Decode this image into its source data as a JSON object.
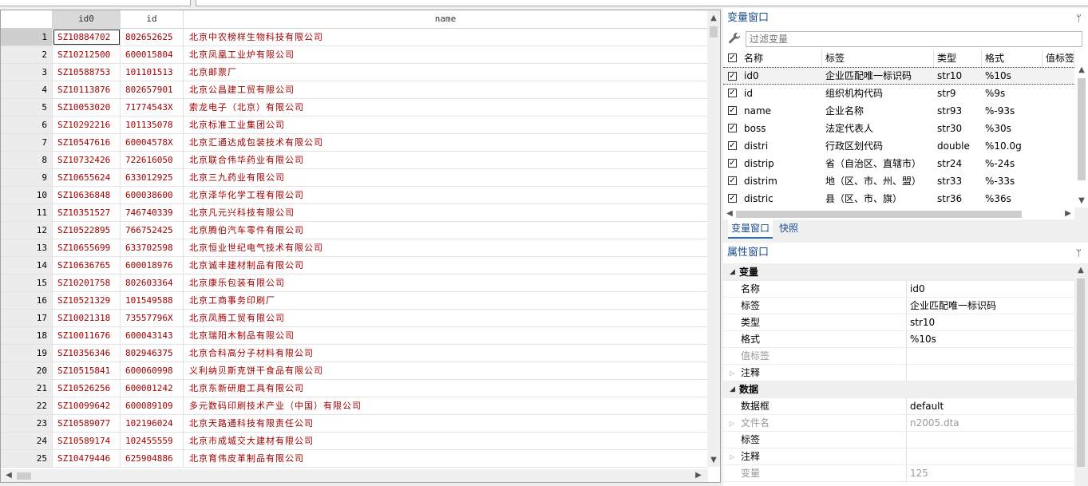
{
  "toolbar": {
    "cmd_left": "",
    "cmd_right": ""
  },
  "grid": {
    "columns": [
      "id0",
      "id",
      "name"
    ],
    "rows": [
      [
        "1",
        "SZ10884702",
        "802652625",
        "北京中农榜样生物科技有限公司"
      ],
      [
        "2",
        "SZ10212500",
        "600015804",
        "北京凤凰工业炉有限公司"
      ],
      [
        "3",
        "SZ10588753",
        "101101513",
        "北京邮票厂"
      ],
      [
        "4",
        "SZ10113876",
        "802657901",
        "北京公昌建工贸有限公司"
      ],
      [
        "5",
        "SZ10053020",
        "71774543X",
        "索龙电子（北京）有限公司"
      ],
      [
        "6",
        "SZ10292216",
        "101135078",
        "北京标准工业集团公司"
      ],
      [
        "7",
        "SZ10547616",
        "60004578X",
        "北京汇通达成包装技术有限公司"
      ],
      [
        "8",
        "SZ10732426",
        "722616050",
        "北京联合伟华药业有限公司"
      ],
      [
        "9",
        "SZ10655624",
        "633012925",
        "北京三九药业有限公司"
      ],
      [
        "10",
        "SZ10636848",
        "600038600",
        "北京泽华化学工程有限公司"
      ],
      [
        "11",
        "SZ10351527",
        "746740339",
        "北京凡元兴科技有限公司"
      ],
      [
        "12",
        "SZ10522895",
        "766752425",
        "北京腾伯汽车零件有限公司"
      ],
      [
        "13",
        "SZ10655699",
        "633702598",
        "北京恒业世纪电气技术有限公司"
      ],
      [
        "14",
        "SZ10636765",
        "600018976",
        "北京诚丰建材制品有限公司"
      ],
      [
        "15",
        "SZ10201758",
        "802603364",
        "北京康乐包装有限公司"
      ],
      [
        "16",
        "SZ10521329",
        "101549588",
        "北京工商事务印刷厂"
      ],
      [
        "17",
        "SZ10021318",
        "73557796X",
        "北京凤腾工贸有限公司"
      ],
      [
        "18",
        "SZ10011676",
        "600043143",
        "北京瑞阳木制品有限公司"
      ],
      [
        "19",
        "SZ10356346",
        "802946375",
        "北京合科高分子材料有限公司"
      ],
      [
        "20",
        "SZ10515841",
        "600060998",
        "义利纳贝斯克饼干食品有限公司"
      ],
      [
        "21",
        "SZ10526256",
        "600001242",
        "北京东新研磨工具有限公司"
      ],
      [
        "22",
        "SZ10099642",
        "600089109",
        "多元数码印刷技术产业（中国）有限公司"
      ],
      [
        "23",
        "SZ10589077",
        "102196024",
        "北京天路通科技有限责任公司"
      ],
      [
        "24",
        "SZ10589174",
        "102455559",
        "北京市成城交大建材有限公司"
      ],
      [
        "25",
        "SZ10479446",
        "625904886",
        "北京育伟皮革制品有限公司"
      ]
    ]
  },
  "variables": {
    "title": "变量窗口",
    "pin": "ᛘ",
    "filter_placeholder": "过滤变量",
    "headers": [
      "名称",
      "标签",
      "类型",
      "格式",
      "值标签"
    ],
    "items": [
      {
        "name": "id0",
        "label": "企业匹配唯一标识码",
        "type": "str10",
        "format": "%10s"
      },
      {
        "name": "id",
        "label": "组织机构代码",
        "type": "str9",
        "format": "%9s"
      },
      {
        "name": "name",
        "label": "企业名称",
        "type": "str93",
        "format": "%-93s"
      },
      {
        "name": "boss",
        "label": "法定代表人",
        "type": "str30",
        "format": "%30s"
      },
      {
        "name": "distri",
        "label": "行政区划代码",
        "type": "double",
        "format": "%10.0g"
      },
      {
        "name": "distrip",
        "label": "省（自治区、直辖市）",
        "type": "str24",
        "format": "%-24s"
      },
      {
        "name": "distrim",
        "label": "地（区、市、州、盟）",
        "type": "str33",
        "format": "%-33s"
      },
      {
        "name": "distric",
        "label": "县（区、市、旗）",
        "type": "str36",
        "format": "%36s"
      }
    ],
    "tabs": [
      "变量窗口",
      "快照"
    ]
  },
  "properties": {
    "title": "属性窗口",
    "pin": "ᛘ",
    "rows": [
      {
        "kind": "group",
        "k": "变量",
        "v": ""
      },
      {
        "kind": "item",
        "k": "名称",
        "v": "id0"
      },
      {
        "kind": "item",
        "k": "标签",
        "v": "企业匹配唯一标识码"
      },
      {
        "kind": "item",
        "k": "类型",
        "v": "str10"
      },
      {
        "kind": "item",
        "k": "格式",
        "v": "%10s"
      },
      {
        "kind": "dim",
        "k": "值标签",
        "v": ""
      },
      {
        "kind": "collapsed",
        "k": "注释",
        "v": ""
      },
      {
        "kind": "group",
        "k": "数据",
        "v": ""
      },
      {
        "kind": "item",
        "k": "数据框",
        "v": "default"
      },
      {
        "kind": "dimc",
        "k": "文件名",
        "v": "n2005.dta"
      },
      {
        "kind": "item",
        "k": "标签",
        "v": ""
      },
      {
        "kind": "collapsed",
        "k": "注释",
        "v": ""
      },
      {
        "kind": "dim",
        "k": "变量",
        "v": "125"
      }
    ]
  }
}
